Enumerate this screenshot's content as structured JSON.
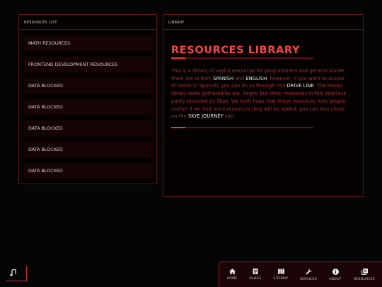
{
  "resources_panel": {
    "header": "RESOURCES LIST",
    "items": [
      {
        "label": "MATH RESOURCES"
      },
      {
        "label": "FRONTEND DEVELOPMENT RESOURCES"
      },
      {
        "label": "DATA BLOCKED"
      },
      {
        "label": "DATA BLOCKED"
      },
      {
        "label": "DATA BLOCKED"
      },
      {
        "label": "DATA BLOCKED"
      },
      {
        "label": "DATA BLOCKED"
      }
    ]
  },
  "library_panel": {
    "header": "LIBRARY",
    "title": "RESOURCES LIBRARY",
    "title_bar_progress": 0.1,
    "bottom_bar_progress": 0.1,
    "lines": {
      "l1": "This is a library of useful resources for programmers and general studie",
      "l2a": "them are in both ",
      "l2b": "SPANISH",
      "l2c": " and ",
      "l2d": "ENGLISH",
      "l2e": ", however, if you want to access",
      "l3a": "of books in Spanish, you can do so through this ",
      "l3b": "DRIVE LINK",
      "l3c": ". The resour",
      "l4": "library were gathered by me, Regre, but other resources in this interface",
      "l5": "partly provided by Skye. We both hope that these resources help people",
      "l6": "useful! If we find more resources they will be added, you can also check",
      "l7a": "on the ",
      "l7b": "SKYE JOURNEY",
      "l7c": " site."
    }
  },
  "music_toggle": {
    "icon": "music-note-icon"
  },
  "navbar": {
    "items": [
      {
        "label": "HOME",
        "icon": "home-icon"
      },
      {
        "label": "BLOGS",
        "icon": "document-icon"
      },
      {
        "label": "SITEMAP",
        "icon": "map-icon"
      },
      {
        "label": "SERVICES",
        "icon": "wrench-icon"
      },
      {
        "label": "ABOUT",
        "icon": "info-icon"
      },
      {
        "label": "RESOURCES",
        "icon": "resources-icon"
      }
    ]
  },
  "colors": {
    "accent": "#f5474a",
    "border": "#5a1416",
    "background": "#050505",
    "item_bg": "#160303",
    "text_muted": "#9b3438"
  }
}
